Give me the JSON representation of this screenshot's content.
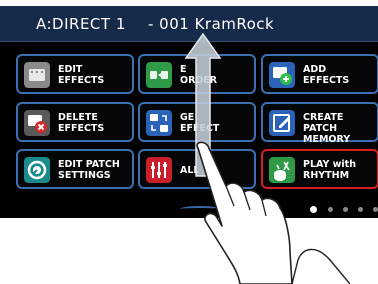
{
  "header": {
    "patch_number": "A:DIRECT 1",
    "patch_name": "- 001 KramRock"
  },
  "menu": {
    "tiles": [
      {
        "id": "edit-effects",
        "label": "EDIT\nEFFECTS",
        "icon": "edit-effects-icon",
        "icon_color": "#8a8a8a",
        "selected": false
      },
      {
        "id": "change-order",
        "label": "E\nORDER",
        "icon": "change-order-icon",
        "icon_color": "#2e9a48",
        "selected": false
      },
      {
        "id": "add-effects",
        "label": "ADD\nEFFECTS",
        "icon": "add-effects-icon",
        "icon_color": "#2a63b8",
        "selected": false
      },
      {
        "id": "delete-effects",
        "label": "DELETE\nEFFECTS",
        "icon": "delete-effects-icon",
        "icon_color": "#5a5a5a",
        "selected": false
      },
      {
        "id": "change-all-effect",
        "label": "GE\nEFFECT",
        "icon": "change-effect-icon",
        "icon_color": "#2a63b8",
        "selected": false
      },
      {
        "id": "create-patch-memory",
        "label": "CREATE PATCH\nMEMORY",
        "icon": "create-patch-icon",
        "icon_color": "#2a63b8",
        "selected": false
      },
      {
        "id": "edit-patch-settings",
        "label": "EDIT PATCH\nSETTINGS",
        "icon": "patch-settings-icon",
        "icon_color": "#1a8a8a",
        "selected": false
      },
      {
        "id": "all",
        "label": "ALL",
        "icon": "all-icon",
        "icon_color": "#c81f2a",
        "selected": false
      },
      {
        "id": "play-with-rhythm",
        "label": "PLAY with\nRHYTHM",
        "icon": "rhythm-icon",
        "icon_color": "#2e9a48",
        "selected": true
      }
    ]
  },
  "pagination": {
    "page_count": 5,
    "active_page": 1
  },
  "gesture": {
    "type": "swipe-up",
    "icon": "hand-pointer-icon"
  },
  "colors": {
    "screen_bg": "#000000",
    "title_bar": "#162a4a",
    "tile_border": "#3d6fb3",
    "selected_border": "#d81f1f"
  }
}
